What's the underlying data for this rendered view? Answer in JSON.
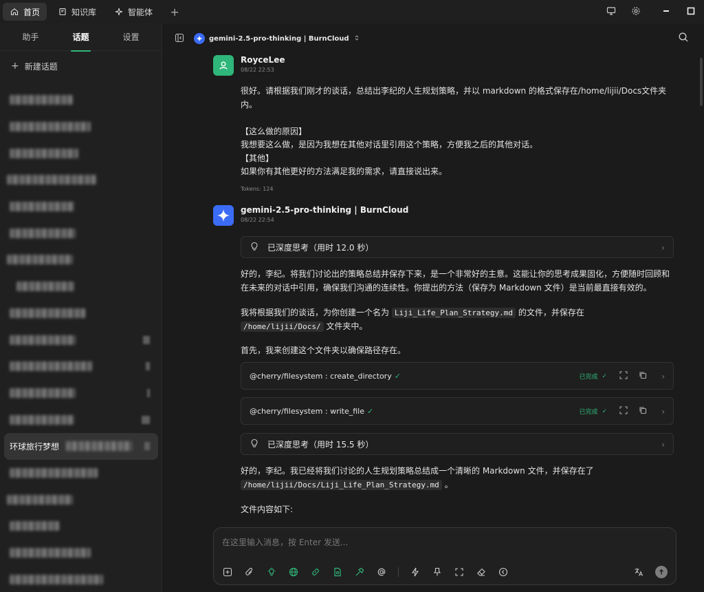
{
  "titlebar": {
    "tabs": [
      {
        "label": "首页",
        "icon": "home-icon",
        "active": true
      },
      {
        "label": "知识库",
        "icon": "book-icon",
        "active": false
      },
      {
        "label": "智能体",
        "icon": "sparkle-icon",
        "active": false
      }
    ],
    "add_tab": "+"
  },
  "sidebar": {
    "tabs": [
      {
        "label": "助手",
        "active": false
      },
      {
        "label": "话题",
        "active": true
      },
      {
        "label": "设置",
        "active": false
      }
    ],
    "new_topic": "新建话题",
    "active_topic": "环球旅行梦想"
  },
  "header": {
    "model": "gemini-2.5-pro-thinking | BurnCloud"
  },
  "messages": {
    "user": {
      "sender": "RoyceLee",
      "time": "08/22 22:53",
      "line1": "很好。请根据我们刚才的谈话，总结出李纪的人生规划策略，并以 markdown 的格式保存在/home/lijii/Docs文件夹内。",
      "reason_title": "【这么做的原因】",
      "reason": "我想要这么做，是因为我想在其他对话里引用这个策略，方便我之后的其他对话。",
      "other_title": "【其他】",
      "other": "如果你有其他更好的方法满足我的需求，请直接说出来。",
      "tokens": "Tokens: 124"
    },
    "ai": {
      "sender": "gemini-2.5-pro-thinking | BurnCloud",
      "time": "08/22 22:54",
      "think1": "已深度思考（用时 12.0 秒）",
      "p1": "好的，李纪。将我们讨论出的策略总结并保存下来，是一个非常好的主意。这能让你的思考成果固化，方便随时回顾和在未来的对话中引用，确保我们沟通的连续性。你提出的方法（保存为 Markdown 文件）是当前最直接有效的。",
      "p2a": "我将根据我们的谈话，为你创建一个名为",
      "p2code1": "Liji_Life_Plan_Strategy.md",
      "p2b": "的文件，并保存在",
      "p2code2": "/home/lijii/Docs/",
      "p2c": "文件夹中。",
      "p3": "首先，我来创建这个文件夹以确保路径存在。",
      "tool1": "@cherry/filesystem : create_directory",
      "tool2": "@cherry/filesystem : write_file",
      "tool_status": "已完成",
      "think2": "已深度思考（用时 15.5 秒）",
      "p4a": "好的，李纪。我已经将我们讨论的人生规划策略总结成一个清晰的 Markdown 文件，并保存在了",
      "p4code": "/home/lijii/Docs/Liji_Life_Plan_Strategy.md",
      "p4b": "。",
      "p5": "文件内容如下:"
    }
  },
  "input": {
    "placeholder": "在这里输入消息，按 Enter 发送..."
  },
  "colors": {
    "accent": "#2fb67a",
    "model_blue": "#3b6cf6",
    "bg": "#1b1b1b"
  }
}
